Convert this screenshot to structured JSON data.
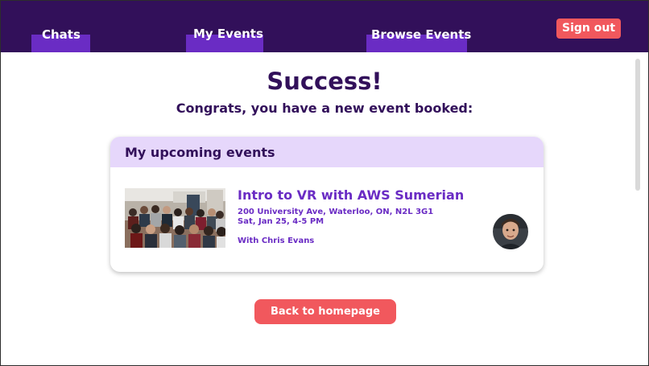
{
  "nav": {
    "tabs": [
      {
        "label": "Chats"
      },
      {
        "label": "My Events"
      },
      {
        "label": "Browse Events"
      }
    ],
    "sign_out_label": "Sign out"
  },
  "main": {
    "title": "Success!",
    "subtitle": "Congrats, you have a new event booked:",
    "card": {
      "header": "My upcoming events",
      "event": {
        "title": "Intro to VR with AWS Sumerian",
        "address": "200 University Ave, Waterloo, ON, N2L 3G1",
        "time": "Sat, Jan 25, 4-5 PM",
        "host": "With Chris Evans"
      }
    },
    "back_button_label": "Back to homepage"
  },
  "colors": {
    "nav_background": "#32105a",
    "nav_tab_accent": "#6a2cc4",
    "primary_text": "#32105a",
    "event_text": "#6a2cc4",
    "card_header": "#e6d7fb",
    "button": "#f1585d"
  }
}
